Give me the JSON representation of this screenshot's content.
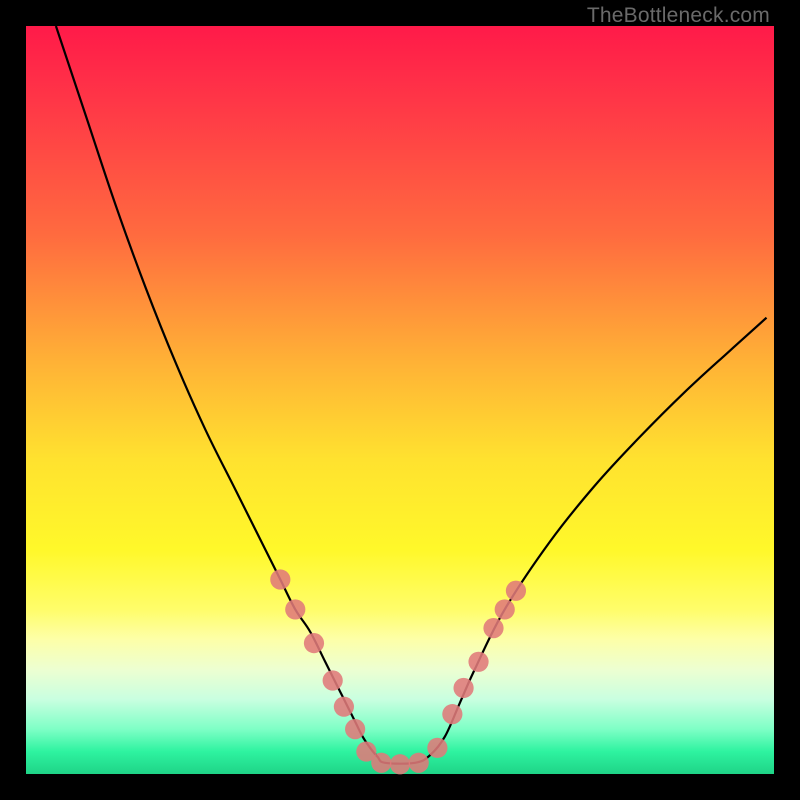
{
  "watermark": "TheBottleneck.com",
  "chart_data": {
    "type": "line",
    "title": "",
    "xlabel": "",
    "ylabel": "",
    "xlim": [
      0,
      100
    ],
    "ylim": [
      0,
      100
    ],
    "legend": false,
    "grid": false,
    "background_gradient_stops": [
      {
        "pos": 0,
        "color": "#ff1a49"
      },
      {
        "pos": 10,
        "color": "#ff3647"
      },
      {
        "pos": 28,
        "color": "#ff6b3f"
      },
      {
        "pos": 45,
        "color": "#ffb236"
      },
      {
        "pos": 58,
        "color": "#ffe22f"
      },
      {
        "pos": 70,
        "color": "#fff82a"
      },
      {
        "pos": 78,
        "color": "#fffd6a"
      },
      {
        "pos": 82,
        "color": "#fdffa8"
      },
      {
        "pos": 86,
        "color": "#edffd1"
      },
      {
        "pos": 90,
        "color": "#c9ffe0"
      },
      {
        "pos": 94,
        "color": "#7effc6"
      },
      {
        "pos": 97,
        "color": "#2ef3a0"
      },
      {
        "pos": 100,
        "color": "#1fd487"
      }
    ],
    "series": [
      {
        "name": "bottleneck-curve",
        "color": "#000000",
        "stroke_width": 2.2,
        "x": [
          4,
          8,
          12,
          16,
          20,
          24,
          28,
          32,
          34,
          36,
          38,
          40,
          42,
          44,
          45,
          46,
          47,
          48,
          52,
          54,
          56,
          58,
          60,
          64,
          70,
          76,
          82,
          88,
          94,
          99
        ],
        "y": [
          100,
          88,
          76,
          65,
          55,
          46,
          38,
          30,
          26,
          22,
          19,
          15,
          11,
          7,
          5,
          3.5,
          2.3,
          1.5,
          1.5,
          2.5,
          5,
          9.5,
          14,
          22,
          31,
          38.5,
          45,
          51,
          56.5,
          61
        ]
      }
    ],
    "markers": {
      "name": "highlight-dots",
      "color": "#e07a7a",
      "radius_pct": 1.35,
      "points": [
        {
          "x": 34.0,
          "y": 26.0
        },
        {
          "x": 36.0,
          "y": 22.0
        },
        {
          "x": 38.5,
          "y": 17.5
        },
        {
          "x": 41.0,
          "y": 12.5
        },
        {
          "x": 42.5,
          "y": 9.0
        },
        {
          "x": 44.0,
          "y": 6.0
        },
        {
          "x": 45.5,
          "y": 3.0
        },
        {
          "x": 47.5,
          "y": 1.5
        },
        {
          "x": 50.0,
          "y": 1.3
        },
        {
          "x": 52.5,
          "y": 1.5
        },
        {
          "x": 55.0,
          "y": 3.5
        },
        {
          "x": 57.0,
          "y": 8.0
        },
        {
          "x": 58.5,
          "y": 11.5
        },
        {
          "x": 60.5,
          "y": 15.0
        },
        {
          "x": 62.5,
          "y": 19.5
        },
        {
          "x": 64.0,
          "y": 22.0
        },
        {
          "x": 65.5,
          "y": 24.5
        }
      ]
    }
  }
}
